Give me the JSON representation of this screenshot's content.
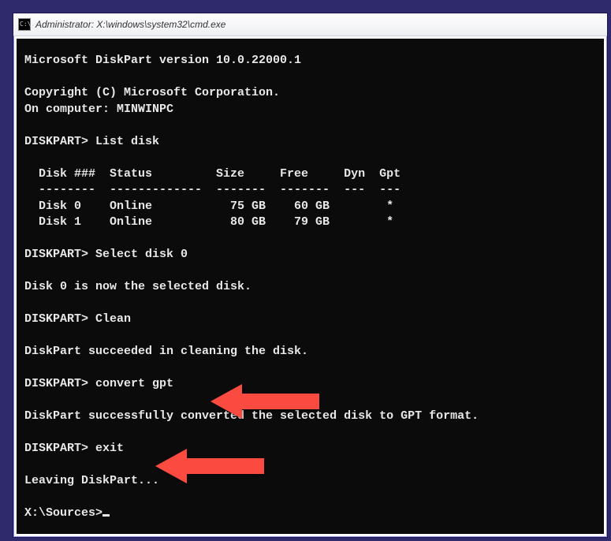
{
  "window": {
    "title": "Administrator: X:\\windows\\system32\\cmd.exe",
    "sysicon_text": "C:\\."
  },
  "terminal": {
    "lines": [
      "Microsoft DiskPart version 10.0.22000.1",
      "",
      "Copyright (C) Microsoft Corporation.",
      "On computer: MINWINPC",
      "",
      "DISKPART> List disk",
      "",
      "  Disk ###  Status         Size     Free     Dyn  Gpt",
      "  --------  -------------  -------  -------  ---  ---",
      "  Disk 0    Online           75 GB    60 GB        *",
      "  Disk 1    Online           80 GB    79 GB        *",
      "",
      "DISKPART> Select disk 0",
      "",
      "Disk 0 is now the selected disk.",
      "",
      "DISKPART> Clean",
      "",
      "DiskPart succeeded in cleaning the disk.",
      "",
      "DISKPART> convert gpt",
      "",
      "DiskPart successfully converted the selected disk to GPT format.",
      "",
      "DISKPART> exit",
      "",
      "Leaving DiskPart...",
      "",
      "X:\\Sources>"
    ]
  },
  "annotations": {
    "arrow1": {
      "points_to": "convert gpt"
    },
    "arrow2": {
      "points_to": "exit"
    }
  }
}
